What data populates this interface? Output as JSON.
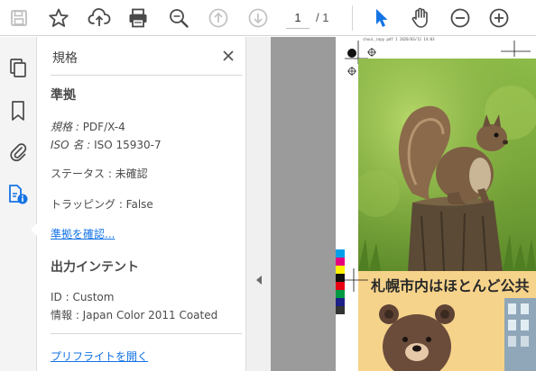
{
  "toolbar": {
    "current_page": "1",
    "total_pages": "/ 1",
    "icons": [
      "save-icon",
      "star-icon",
      "upload-cloud-icon",
      "print-icon",
      "zoom-search-icon",
      "arrow-up-icon",
      "arrow-down-icon",
      "select-arrow-icon",
      "hand-icon",
      "zoom-out-icon",
      "zoom-in-icon"
    ]
  },
  "rail": {
    "icons": [
      "page-thumbnails-icon",
      "bookmark-icon",
      "attachment-icon",
      "standards-icon"
    ]
  },
  "panel": {
    "title": "規格",
    "compliance": {
      "heading": "準拠",
      "standard_key": "規格",
      "standard_sep": " : ",
      "standard_value": "PDF/X-4",
      "iso_key": "ISO 名",
      "iso_sep": " : ",
      "iso_value": "ISO 15930-7",
      "status": "ステータス : 未確認",
      "trapping": "トラッピング : False",
      "verify_link": "準拠を確認..."
    },
    "output_intent": {
      "heading": "出力インテント",
      "id_line": "ID : Custom",
      "info_line": "情報 : Japan Color 2011 Coated",
      "preflight_link": "プリフライトを開く"
    }
  },
  "document": {
    "slug_line": "chuui_copy.pdf  1  2020/03/11  14:03",
    "banner_text": "札幌市内はほとんど公共"
  },
  "colors": {
    "accent": "#1473e6",
    "panel_text": "#4b4b4b",
    "doc_background": "#9b9b9b",
    "banner": "#f6d38a"
  }
}
